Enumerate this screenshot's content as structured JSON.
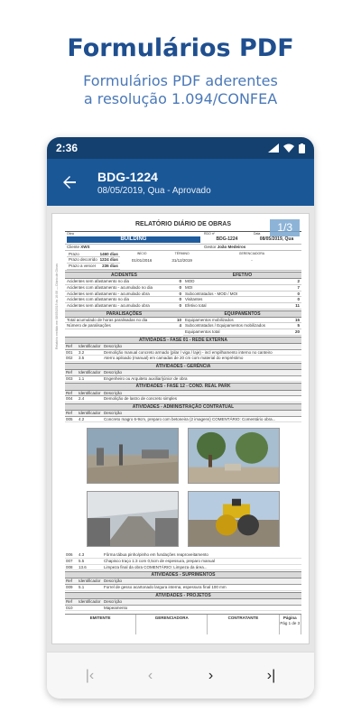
{
  "promo": {
    "title": "Formulários PDF",
    "subtitle_line1": "Formulários PDF aderentes",
    "subtitle_line2": "a resolução 1.094/CONFEA"
  },
  "status": {
    "time": "2:36"
  },
  "appbar": {
    "title": "BDG-1224",
    "subtitle": "08/05/2019, Qua - Aprovado"
  },
  "pdf": {
    "page_indicator": "1/3",
    "side_note": "Relatório emitido em 08/05/2019 às 16:06 — Diário de Obras",
    "report_title": "RELATÓRIO DIÁRIO DE OBRAS",
    "obra_label": "Obra",
    "obra_value": "BUILDING",
    "rdo_label": "RDO nº",
    "rdo_value": "BDG-1224",
    "data_label": "Data",
    "data_value": "08/05/2019, Qua",
    "cliente_label": "Cliente",
    "cliente_value": "XWS",
    "gestor_label": "Gestor",
    "gestor_value": "João Medeiros",
    "prazos": [
      {
        "label": "Prazo",
        "value": "1460 dias"
      },
      {
        "label": "Prazo decorrido",
        "value": "1224 dias"
      },
      {
        "label": "Prazo a vencer",
        "value": "236 dias"
      }
    ],
    "inicio_label": "INÍCIO",
    "inicio_value": "01/01/2016",
    "termino_label": "TÉRMINO",
    "termino_value": "31/12/2019",
    "gerenciadora_label": "GERENCIADORA",
    "gerenciadora_value": "-",
    "acidentes_head": "ACIDENTES",
    "efetivo_head": "EFETIVO",
    "acidentes": [
      {
        "label": "Acidentes sem afastamento no dia",
        "value": "0"
      },
      {
        "label": "Acidentes com afastamento - acumulado no dia",
        "value": "0"
      },
      {
        "label": "Acidentes sem afastamento - acumulado obra",
        "value": "0"
      },
      {
        "label": "Acidentes com afastamento no dia",
        "value": "0"
      },
      {
        "label": "Acidentes sem afastamento - acumulado obra",
        "value": "0"
      }
    ],
    "efetivo": [
      {
        "label": "MOD",
        "value": "2"
      },
      {
        "label": "MOI",
        "value": "7"
      },
      {
        "label": "Subcontratados - MOD / MOI",
        "value": "0"
      },
      {
        "label": "Visitantes",
        "value": "0"
      },
      {
        "label": "Efetivo total",
        "value": "11"
      }
    ],
    "paralisacoes_head": "PARALISAÇÕES",
    "equipamentos_head": "EQUIPAMENTOS",
    "paralisacoes": [
      {
        "label": "Total acumulado de horas paralisadas no dia",
        "value": "10"
      },
      {
        "label": "Número de paralisações",
        "value": "4"
      }
    ],
    "equipamentos": [
      {
        "label": "Equipamentos mobilizados",
        "value": "15"
      },
      {
        "label": "Subcontratados / Equipamentos mobilizados",
        "value": "5"
      },
      {
        "label": "Equipamentos total",
        "value": "20"
      }
    ],
    "col_ref": "Ref",
    "col_id": "Identificador",
    "col_desc": "Descrição",
    "sec_fase01": "ATIVIDADES - FASE 01 - REDE EXTERNA",
    "fase01_rows": [
      {
        "ref": "001",
        "id": "3.2",
        "desc": "Demolição manual concreto armado (pilar / viga / laje) - incl empilhamento interno no canteiro"
      },
      {
        "ref": "002",
        "id": "3.5",
        "desc": "Aterro apiloado (manual) em camadas de 20 cm com material do empréstimo"
      }
    ],
    "sec_gerencia": "ATIVIDADES - GERÊNCIA",
    "gerencia_rows": [
      {
        "ref": "003",
        "id": "1.1",
        "desc": "Engenheiro ou Arquiteto auxiliar/júnior de obra"
      }
    ],
    "sec_fase12": "ATIVIDADES - FASE 12 - COND. REAL PARK",
    "fase12_rows": [
      {
        "ref": "004",
        "id": "2.4",
        "desc": "Demolição de lastro de concreto simples"
      }
    ],
    "sec_adm": "ATIVIDADES - ADMINISTRAÇÃO CONTRATUAL",
    "adm_rows_top": [
      {
        "ref": "005",
        "id": "4.2",
        "desc": "Concreto magro 6-9cm, preparo com betoneira (2 imagens) COMENTÁRIO: Comentário obra..."
      }
    ],
    "adm_rows_bottom": [
      {
        "ref": "006",
        "id": "4.3",
        "desc": "Fôrma tábua pinho/pinho em fundações reaproveitamento"
      },
      {
        "ref": "007",
        "id": "5.5",
        "desc": "Chapisco traço 1:3 com 0,5cm de espessura, preparo manual"
      },
      {
        "ref": "008",
        "id": "13.6",
        "desc": "Limpeza final da obra COMENTÁRIO: Limpeza da área..."
      }
    ],
    "sec_suprimentos": "ATIVIDADES - SUPRIMENTOS",
    "suprimentos_rows": [
      {
        "ref": "009",
        "id": "5.1",
        "desc": "Forrel de gesso acartonado largura interna, espessura final 100 mm"
      }
    ],
    "sec_projetos": "ATIVIDADES - PROJETOS",
    "projetos_rows": [
      {
        "ref": "010",
        "id": "",
        "desc": "Mapeamento"
      }
    ],
    "sign_emitente": "EMITENTE",
    "sign_gerenciadora": "GERENCIADORA",
    "sign_contratante": "CONTRATANTE",
    "sign_pagina": "Página",
    "footer_page": "Pág 1 de 3"
  },
  "nav": {
    "first": "|‹",
    "prev": "‹",
    "next": "›",
    "last": "›|"
  },
  "colors": {
    "appbar": "#1a5797",
    "statusbar": "#14406f",
    "accent": "#1f4f8f"
  }
}
